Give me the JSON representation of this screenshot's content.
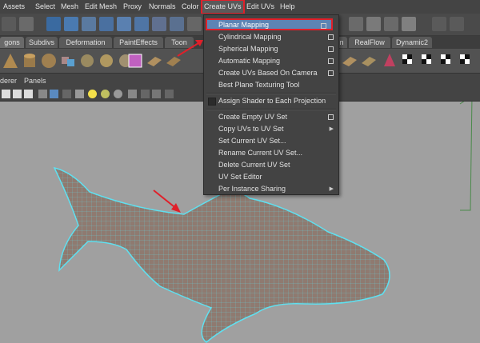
{
  "menubar": {
    "items": [
      "Assets",
      "Select",
      "Mesh",
      "Edit Mesh",
      "Proxy",
      "Normals",
      "Color",
      "Create UVs",
      "Edit UVs",
      "Help"
    ],
    "active": "Create UVs"
  },
  "shelf_tabs": [
    "gons",
    "Subdivs",
    "Deformation",
    "PaintEffects",
    "Toon",
    "n",
    "RealFlow",
    "Dynamic2"
  ],
  "panel_menu": [
    "derer",
    "Panels"
  ],
  "create_uvs_menu": {
    "group1": [
      {
        "label": "Planar Mapping",
        "option": true,
        "highlighted": true
      },
      {
        "label": "Cylindrical Mapping",
        "option": true
      },
      {
        "label": "Spherical Mapping",
        "option": true
      },
      {
        "label": "Automatic Mapping",
        "option": true
      },
      {
        "label": "Create UVs Based On Camera",
        "option": true
      },
      {
        "label": "Best Plane Texturing Tool",
        "option": false
      }
    ],
    "group2": [
      {
        "label": "Assign Shader to Each Projection",
        "checkbox": true
      }
    ],
    "group3": [
      {
        "label": "Create Empty UV Set",
        "option": true
      },
      {
        "label": "Copy UVs to UV Set",
        "submenu": true
      },
      {
        "label": "Set Current UV Set..."
      },
      {
        "label": "Rename Current UV Set..."
      },
      {
        "label": "Delete Current UV Set"
      },
      {
        "label": "UV Set Editor"
      },
      {
        "label": "Per Instance Sharing",
        "submenu": true
      }
    ]
  },
  "colors": {
    "highlight": "#5d84b4",
    "annotation_red": "#e0202a",
    "wire": "#5fe0f0",
    "mesh": "#8f7a70",
    "viewport": "#a0a0a0"
  },
  "icons": {
    "option_box": "option-box-icon",
    "submenu": "submenu-arrow-icon"
  }
}
